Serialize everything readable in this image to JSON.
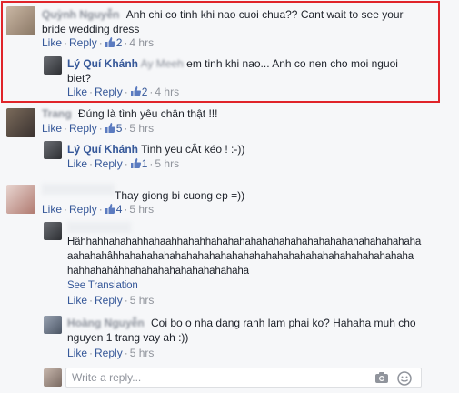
{
  "comments": [
    {
      "id": "c1",
      "author_blurred": "Quỳnh Nguyễn",
      "text_line1": "Anh chi co tinh khi nao cuoi chua?? Cant wait to see your",
      "text_line2": "bride wedding dress",
      "like": "Like",
      "reply": "Reply",
      "likes": "2",
      "time": "4 hrs"
    },
    {
      "id": "r1",
      "author": "Lý Quí Khánh",
      "tag_blurred": "Ay Meeh",
      "text_line1": "em tinh khi nao... Anh co nen cho moi nguoi",
      "text_line2": "biet?",
      "like": "Like",
      "reply": "Reply",
      "likes": "2",
      "time": "4 hrs"
    },
    {
      "id": "c2",
      "author_blurred": "Trang",
      "text": "Đúng là tình yêu chân thật !!!",
      "like": "Like",
      "reply": "Reply",
      "likes": "5",
      "time": "5 hrs"
    },
    {
      "id": "r2",
      "author": "Lý Quí Khánh",
      "text": "Tinh yeu cẮt kéo ! :-))",
      "like": "Like",
      "reply": "Reply",
      "likes": "1",
      "time": "5 hrs"
    },
    {
      "id": "c3",
      "text": "Thay giong bi cuong ep =))",
      "like": "Like",
      "reply": "Reply",
      "likes": "4",
      "time": "5 hrs"
    },
    {
      "id": "r3",
      "text_line1": "Hâhhahhahahahhahaahhahahhahahahahahahahahahahahahahahahahahaha",
      "text_line2": "aahahahâhhahahahahahahahahahahahahahahahahahahahahahahahahaha",
      "text_line3": "hahhahahâhhahahahahahahahahahaha",
      "see_translation": "See Translation",
      "like": "Like",
      "reply": "Reply",
      "time": "5 hrs"
    },
    {
      "id": "r4",
      "author_blurred": "Hoàng Nguyễn",
      "text_line1": "Coi bo o nha dang ranh lam phai ko? Hahaha muh cho",
      "text_line2": "nguyen 1 trang vay ah :))",
      "like": "Like",
      "reply": "Reply",
      "time": "5 hrs"
    }
  ],
  "composer": {
    "placeholder": "Write a reply..."
  },
  "colors": {
    "link": "#365899",
    "meta": "#90949c",
    "highlight": "#e0242a"
  }
}
